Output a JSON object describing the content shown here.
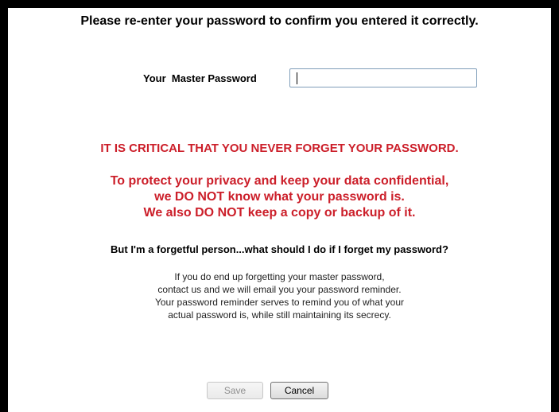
{
  "heading": "Please re-enter your password to confirm you entered it correctly.",
  "password": {
    "label": "Your  Master Password",
    "value": ""
  },
  "warning": {
    "critical": "IT IS CRITICAL THAT YOU NEVER FORGET YOUR PASSWORD.",
    "lines": [
      "To protect your privacy and keep your data confidential,",
      "we DO NOT know what your password is.",
      "We also DO NOT keep a copy or backup of it."
    ],
    "color": "#cc1f2a"
  },
  "faq": {
    "question": "But I'm a forgetful person...what should I do if I forget my password?",
    "answer_lines": [
      "If you do end up forgetting your master password,",
      "contact us and we will email you your password reminder.",
      "Your password reminder serves to remind you of what your",
      "actual password is, while still maintaining its secrecy."
    ]
  },
  "buttons": {
    "save_label": "Save",
    "save_state": "disabled",
    "cancel_label": "Cancel"
  }
}
